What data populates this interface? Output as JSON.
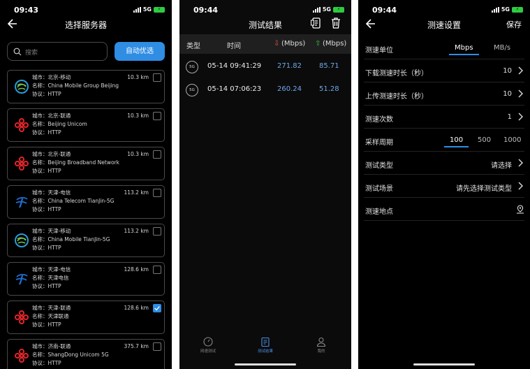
{
  "panel1": {
    "status": {
      "time": "09:43",
      "network": "5G"
    },
    "title": "选择服务器",
    "search_placeholder": "搜索",
    "auto_button": "自动优选",
    "servers": [
      {
        "city": "城市：北京-移动",
        "name": "名称：China Mobile Group Beijing",
        "protocol": "协议：HTTP",
        "distance": "10.3 km",
        "logo": "china-mobile-logo",
        "checked": false
      },
      {
        "city": "城市：北京-联通",
        "name": "名称：Beijing Unicom",
        "protocol": "协议：HTTP",
        "distance": "10.3 km",
        "logo": "china-unicom-logo",
        "checked": false
      },
      {
        "city": "城市：北京-联通",
        "name": "名称：Beijing Broadband Network",
        "protocol": "协议：HTTP",
        "distance": "10.3 km",
        "logo": "china-unicom-logo",
        "checked": false
      },
      {
        "city": "城市：天津-电信",
        "name": "名称：China Telecom TianJin-5G",
        "protocol": "协议：HTTP",
        "distance": "113.2 km",
        "logo": "china-telecom-logo",
        "checked": false
      },
      {
        "city": "城市：天津-移动",
        "name": "名称：China Mobile TianJin-5G",
        "protocol": "协议：HTTP",
        "distance": "113.2 km",
        "logo": "china-mobile-logo",
        "checked": false
      },
      {
        "city": "城市：天津-电信",
        "name": "名称：天津电信",
        "protocol": "协议：HTTP",
        "distance": "128.6 km",
        "logo": "china-telecom-logo",
        "checked": false
      },
      {
        "city": "城市：天津-联通",
        "name": "名称：天津联通",
        "protocol": "协议：HTTP",
        "distance": "128.6 km",
        "logo": "china-unicom-logo",
        "checked": true
      },
      {
        "city": "城市：济南-联通",
        "name": "名称：ShangDong Unicom 5G",
        "protocol": "协议：HTTP",
        "distance": "375.7 km",
        "logo": "china-unicom-logo",
        "checked": false
      }
    ]
  },
  "panel2": {
    "status": {
      "time": "09:44",
      "network": "5G"
    },
    "title": "测试结果",
    "headers": {
      "type": "类型",
      "time": "时间",
      "down": "(Mbps)",
      "up": "(Mbps)"
    },
    "rows": [
      {
        "badge": "5G",
        "time": "05-14 09:41:29",
        "down": "271.82",
        "up": "85.71"
      },
      {
        "badge": "5G",
        "time": "05-14 07:06:23",
        "down": "260.24",
        "up": "51.28"
      }
    ],
    "tabs": [
      {
        "label": "网速测试",
        "icon": "speedometer-icon",
        "active": false
      },
      {
        "label": "测试结果",
        "icon": "clipboard-icon",
        "active": true
      },
      {
        "label": "我的",
        "icon": "user-icon",
        "active": false
      }
    ]
  },
  "panel3": {
    "status": {
      "time": "09:44",
      "network": "5G"
    },
    "title": "测速设置",
    "save_label": "保存",
    "unit": {
      "label": "测速单位",
      "options": [
        "Mbps",
        "MB/s"
      ],
      "selected": "Mbps"
    },
    "download_duration": {
      "label": "下载测速时长（秒）",
      "value": "10"
    },
    "upload_duration": {
      "label": "上传测速时长（秒）",
      "value": "10"
    },
    "test_count": {
      "label": "测速次数",
      "value": "1"
    },
    "sampling": {
      "label": "采样周期",
      "options": [
        "100",
        "500",
        "1000"
      ],
      "selected": "100"
    },
    "test_type": {
      "label": "测试类型",
      "value": "请选择"
    },
    "test_scene": {
      "label": "测试场景",
      "value": "请先选择测试类型"
    },
    "test_location": {
      "label": "测速地点"
    }
  },
  "colors": {
    "accent": "#2f8de4",
    "download": "#e8553a",
    "upload": "#2ecc40",
    "value": "#6fa8e8"
  }
}
